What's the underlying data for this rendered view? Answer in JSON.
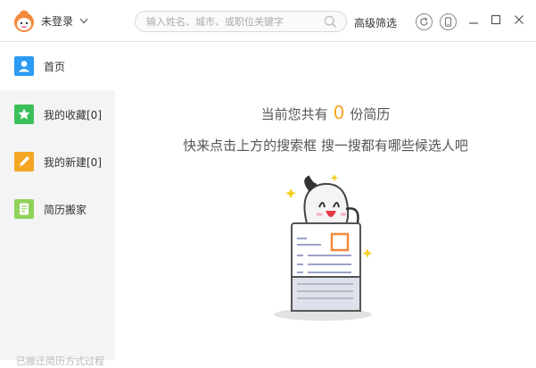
{
  "header": {
    "user_name": "未登录",
    "search_placeholder": "输入姓名、城市、或职位关键字",
    "advanced_filter_label": "高级筛选"
  },
  "sidebar": {
    "items": [
      {
        "label": "首页",
        "icon": "person-icon",
        "color": "#2b9af3",
        "active": true
      },
      {
        "label": "我的收藏[0]",
        "icon": "star-icon",
        "color": "#3bbf5b",
        "active": false
      },
      {
        "label": "我的新建[0]",
        "icon": "pencil-icon",
        "color": "#f5a623",
        "active": false
      },
      {
        "label": "简历搬家",
        "icon": "document-icon",
        "color": "#8fd35a",
        "active": false
      }
    ],
    "footer_text": "已搬迁简历方式过程"
  },
  "main": {
    "line1_prefix": "当前您共有",
    "resume_count": "0",
    "line1_suffix": "份简历",
    "line2": "快来点击上方的搜索框  搜一搜都有哪些候选人吧"
  },
  "colors": {
    "accent_orange": "#f5a623",
    "accent_blue": "#2b9af3"
  }
}
